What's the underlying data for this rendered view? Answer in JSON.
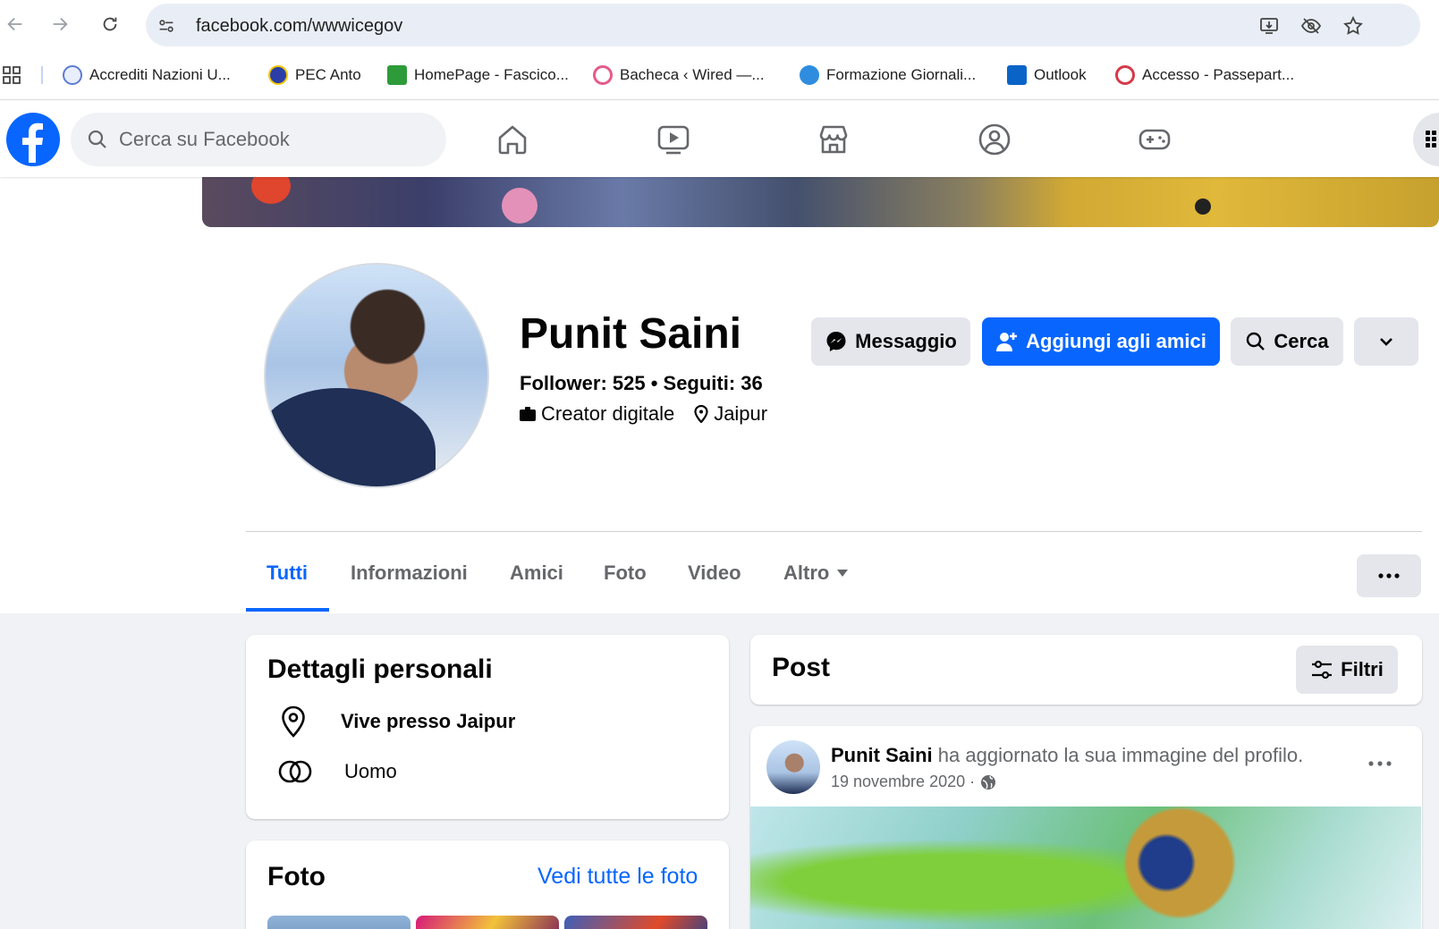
{
  "browser": {
    "url": "facebook.com/wwwicegov",
    "bookmarks": [
      {
        "label": "Accrediti Nazioni U...",
        "icon": "un-icon",
        "color": "#5b7bd5"
      },
      {
        "label": "PEC Anto",
        "icon": "pec-icon",
        "color": "#2b3ea8"
      },
      {
        "label": "HomePage - Fascico...",
        "icon": "fascicolo-icon",
        "color": "#2e9b3a"
      },
      {
        "label": "Bacheca ‹ Wired —...",
        "icon": "wired-icon",
        "color": "#e45b8a"
      },
      {
        "label": "Formazione Giornali...",
        "icon": "formazione-icon",
        "color": "#2f8ddf"
      },
      {
        "label": "Outlook",
        "icon": "outlook-icon",
        "color": "#0a64c8"
      },
      {
        "label": "Accesso - Passepart...",
        "icon": "passepartout-icon",
        "color": "#d43a4a"
      }
    ]
  },
  "facebook": {
    "search_placeholder": "Cerca su Facebook",
    "brand_color": "#0866ff"
  },
  "profile": {
    "name": "Punit Saini",
    "stats": "Follower: 525 • Seguiti: 36",
    "category": "Creator digitale",
    "location": "Jaipur",
    "buttons": {
      "message": "Messaggio",
      "add_friend": "Aggiungi agli amici",
      "search": "Cerca"
    },
    "tabs": [
      "Tutti",
      "Informazioni",
      "Amici",
      "Foto",
      "Video",
      "Altro"
    ]
  },
  "details": {
    "title": "Dettagli personali",
    "lives": "Vive presso Jaipur",
    "gender": "Uomo"
  },
  "photos": {
    "title": "Foto",
    "see_all": "Vedi tutte le foto"
  },
  "posts": {
    "title": "Post",
    "filter": "Filtri",
    "item": {
      "author": "Punit Saini",
      "action": " ha aggiornato la sua immagine del profilo.",
      "date": "19 novembre 2020 ·"
    }
  }
}
